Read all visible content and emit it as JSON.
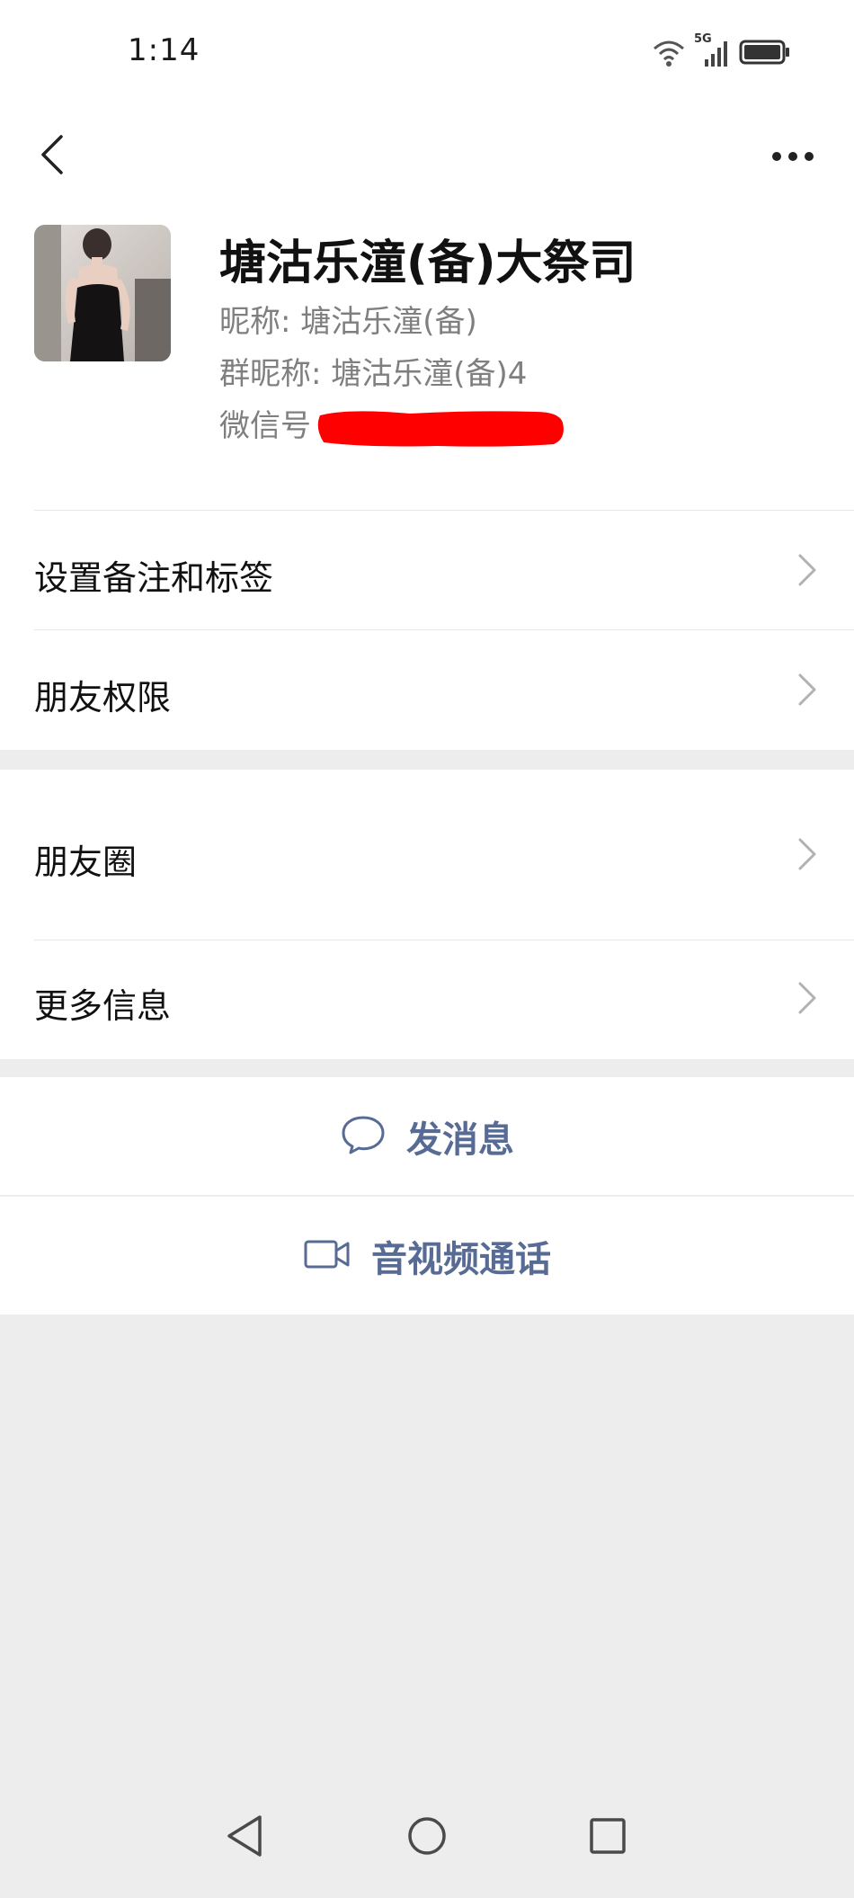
{
  "status_bar": {
    "time": "1:14",
    "network_label": "5G"
  },
  "nav": {
    "back_icon": "chevron-left-icon",
    "more_icon": "more-horizontal-icon"
  },
  "profile": {
    "name": "塘沽乐潼(备)大祭司",
    "nickname_key": "昵称:",
    "nickname_value": "塘沽乐潼(备)",
    "group_nickname_key": "群昵称:",
    "group_nickname_value": "塘沽乐潼(备)4",
    "wechat_id_key": "微信号",
    "redaction_color": "#ff0000"
  },
  "rows": {
    "remark": "设置备注和标签",
    "permissions": "朋友权限",
    "moments": "朋友圈",
    "more_info": "更多信息"
  },
  "actions": {
    "message": "发消息",
    "call": "音视频通话",
    "accent_color": "#576b95"
  },
  "colors": {
    "background": "#ededed",
    "surface": "#ffffff"
  }
}
